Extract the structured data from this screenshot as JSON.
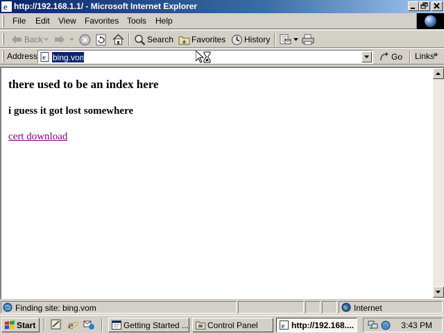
{
  "window": {
    "title": "http://192.168.1.1/ - Microsoft Internet Explorer",
    "titlebar_color": "#0a246a"
  },
  "menu": [
    "File",
    "Edit",
    "View",
    "Favorites",
    "Tools",
    "Help"
  ],
  "toolbar": {
    "back": "Back",
    "search": "Search",
    "favorites": "Favorites",
    "history": "History"
  },
  "address": {
    "label": "Address",
    "value": "bing.vom",
    "go": "Go",
    "links": "Links"
  },
  "page": {
    "heading": "there used to be an index here",
    "subheading": "i guess it got lost somewhere",
    "link_text": "cert download",
    "link_color": "#800080"
  },
  "status": {
    "text": "Finding site: bing.vom",
    "zone": "Internet"
  },
  "taskbar": {
    "start": "Start",
    "tasks": [
      "Getting Started ...",
      "Control Panel",
      "http://192.168...."
    ],
    "active_task": "http://192.168....",
    "clock": "3:43 PM"
  }
}
